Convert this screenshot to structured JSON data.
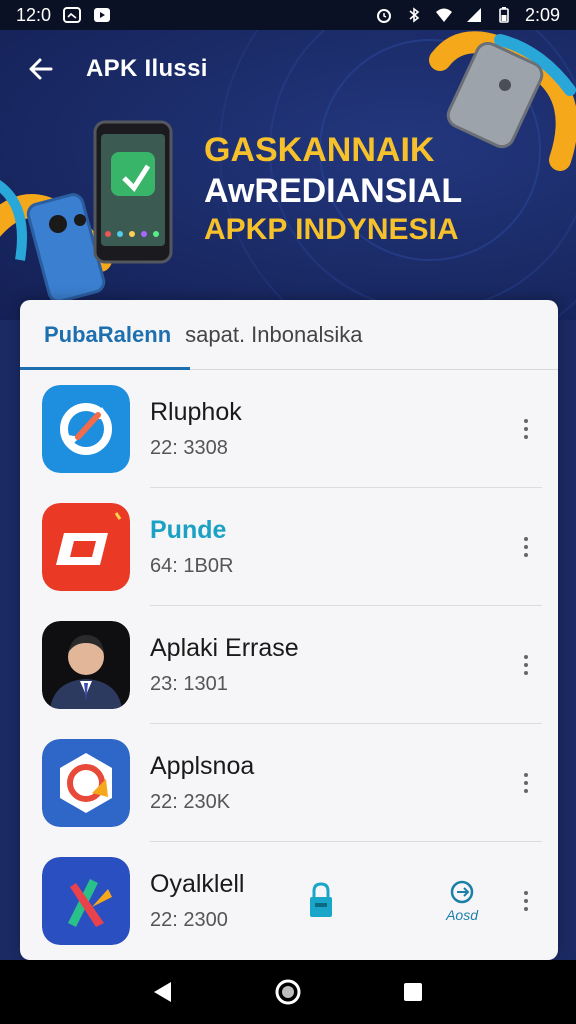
{
  "status_bar": {
    "time_left": "12:0",
    "time_right": "2:09",
    "icons_left": [
      "image-notification-icon",
      "youtube-notification-icon"
    ],
    "icons_right": [
      "alarm-icon",
      "bluetooth-icon",
      "wifi-icon",
      "signal-icon",
      "battery-icon"
    ]
  },
  "header": {
    "title": "APK Ilussi",
    "back_icon": "back-arrow-icon"
  },
  "banner": {
    "line1": "GASKANNAIK",
    "line2": "AwREDIANSIAL",
    "line3": "APKP INDYNESIA"
  },
  "tabs": [
    {
      "label": "PubaRalenn",
      "active": true
    },
    {
      "label": "sapat. Inbonalsika",
      "active": false
    }
  ],
  "apps": [
    {
      "name": "Rluphok",
      "meta": "22: 3308",
      "icon": "sync-app-icon",
      "highlight": false
    },
    {
      "name": "Punde",
      "meta": "64: 1B0R",
      "icon": "red-square-app-icon",
      "highlight": true
    },
    {
      "name": "Aplaki Errase",
      "meta": "23: 1301",
      "icon": "person-avatar-app-icon",
      "highlight": false
    },
    {
      "name": "Applsnoa",
      "meta": "22: 230K",
      "icon": "hexagon-camera-app-icon",
      "highlight": false
    },
    {
      "name": "Oyalklell",
      "meta": "22: 2300",
      "icon": "x-logo-app-icon",
      "highlight": false
    }
  ],
  "last_row_actions": {
    "lock_icon": "lock-icon",
    "read_icon": "sync-circle-icon",
    "read_label": "Aosd"
  },
  "colors": {
    "accent": "#1d6fb0",
    "banner_yellow": "#f6c12a",
    "banner_bg": "#1b2a63"
  },
  "navbar": {
    "back": "triangle-back-icon",
    "home": "circle-home-icon",
    "recents": "square-recents-icon"
  }
}
